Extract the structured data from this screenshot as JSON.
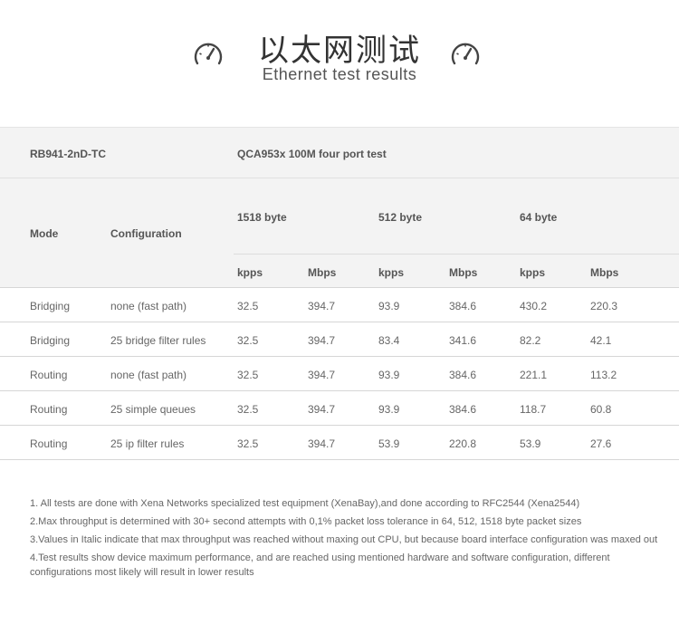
{
  "header": {
    "title_cn": "以太网测试",
    "title_en": "Ethernet test results"
  },
  "table": {
    "model": "RB941-2nD-TC",
    "test_name": "QCA953x 100M four port test",
    "col_mode": "Mode",
    "col_configuration": "Configuration",
    "packet_sizes": [
      "1518 byte",
      "512 byte",
      "64 byte"
    ],
    "units": [
      "kpps",
      "Mbps",
      "kpps",
      "Mbps",
      "kpps",
      "Mbps"
    ],
    "rows": [
      {
        "mode": "Bridging",
        "config": "none (fast path)",
        "v": [
          "32.5",
          "394.7",
          "93.9",
          "384.6",
          "430.2",
          "220.3"
        ]
      },
      {
        "mode": "Bridging",
        "config": "25 bridge filter rules",
        "v": [
          "32.5",
          "394.7",
          "83.4",
          "341.6",
          "82.2",
          "42.1"
        ]
      },
      {
        "mode": "Routing",
        "config": "none (fast path)",
        "v": [
          "32.5",
          "394.7",
          "93.9",
          "384.6",
          "221.1",
          "113.2"
        ]
      },
      {
        "mode": "Routing",
        "config": "25 simple queues",
        "v": [
          "32.5",
          "394.7",
          "93.9",
          "384.6",
          "118.7",
          "60.8"
        ]
      },
      {
        "mode": "Routing",
        "config": "25 ip filter rules",
        "v": [
          "32.5",
          "394.7",
          "53.9",
          "220.8",
          "53.9",
          "27.6"
        ]
      }
    ]
  },
  "notes": [
    "1. All tests are done with Xena Networks specialized test equipment (XenaBay),and done according to RFC2544 (Xena2544)",
    "2.Max throughput is determined with 30+ second attempts with 0,1% packet loss tolerance in 64, 512, 1518 byte packet sizes",
    "3.Values in Italic indicate that max throughput was reached without maxing out CPU, but because board interface configuration was maxed out",
    "4.Test results show  device maximum performance, and are reached using mentioned hardware and software configuration, different configurations most likely will result in lower results"
  ],
  "icons": {
    "left": "speedometer-icon",
    "right": "speedometer-icon"
  }
}
